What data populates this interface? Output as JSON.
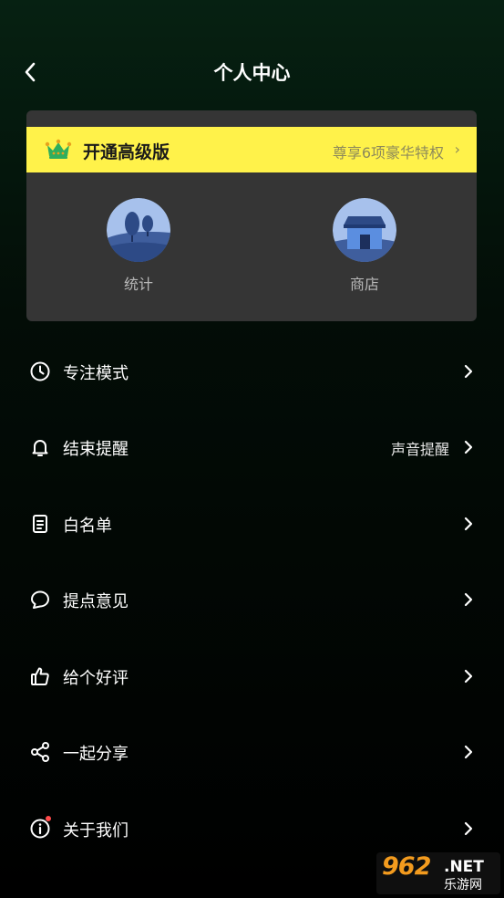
{
  "header": {
    "title": "个人中心"
  },
  "vip": {
    "title": "开通高级版",
    "benefit": "尊享6项豪华特权"
  },
  "features": [
    {
      "label": "统计",
      "icon": "landscape-trees-icon"
    },
    {
      "label": "商店",
      "icon": "shop-icon"
    }
  ],
  "menu": [
    {
      "label": "专注模式",
      "value": "",
      "icon": "clock-icon"
    },
    {
      "label": "结束提醒",
      "value": "声音提醒",
      "icon": "bell-icon"
    },
    {
      "label": "白名单",
      "value": "",
      "icon": "document-icon"
    },
    {
      "label": "提点意见",
      "value": "",
      "icon": "chat-bubble-icon"
    },
    {
      "label": "给个好评",
      "value": "",
      "icon": "thumbs-up-icon"
    },
    {
      "label": "一起分享",
      "value": "",
      "icon": "share-icon"
    },
    {
      "label": "关于我们",
      "value": "",
      "icon": "info-icon",
      "badge": "red-dot"
    }
  ],
  "watermark": {
    "number": "962",
    "suffix": ".NET",
    "site_cn": "乐游网"
  },
  "colors": {
    "vip_banner": "#fff24a",
    "card_bg": "#353535",
    "accent_orange": "#f39b1e",
    "badge_red": "#ff4a4a"
  }
}
